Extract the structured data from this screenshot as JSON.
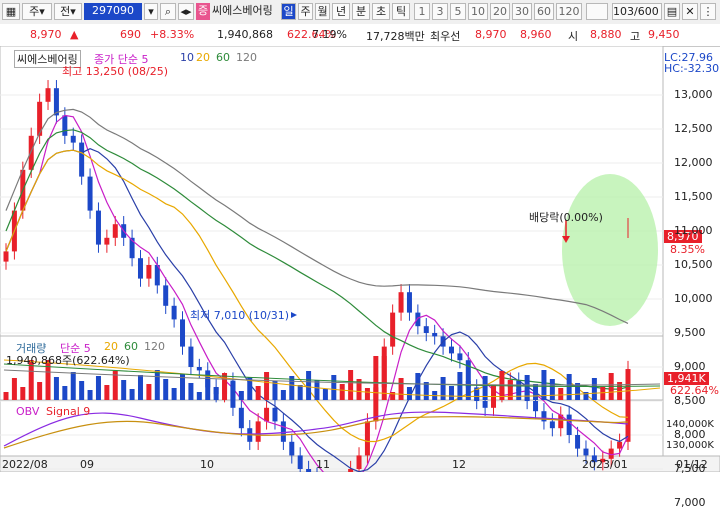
{
  "toolbar": {
    "type_selector": "주",
    "market_selector": "전",
    "code": "297090",
    "name_badge": "증",
    "stock_name": "씨에스베어링",
    "periods": [
      "일",
      "주",
      "월",
      "년",
      "분",
      "초",
      "틱"
    ],
    "active_period": "일",
    "minutes": [
      "1",
      "3",
      "5",
      "10",
      "20",
      "30",
      "60",
      "120"
    ],
    "count": "103/600"
  },
  "quote": {
    "price": "8,970",
    "change_arrow": "▲",
    "change": "690",
    "change_pct": "+8.33%",
    "volume": "1,940,868",
    "volume_pct": "622.64%",
    "turnover": "7.19%",
    "amount": "17,728백만",
    "best_label": "최우선",
    "ask": "8,970",
    "bid": "8,960",
    "open_label": "시",
    "open": "8,880",
    "high_label": "고",
    "high": "9,450"
  },
  "colors": {
    "up": "#e8202a",
    "down": "#1c48c8",
    "ma5": "#c81ec8",
    "ma10": "#2a3fa8",
    "ma20": "#e8a800",
    "ma60": "#2e8b3a",
    "ma120": "#7a7a7a"
  },
  "price_panel": {
    "name": "씨에스베어링",
    "legend_close": "종가 단순 5",
    "ma_labels": [
      "10",
      "20",
      "60",
      "120"
    ],
    "high_note": "최고 13,250 (08/25)",
    "low_note": "최저 7,010 (10/31)",
    "dividend_note": "배당락(0.00%)",
    "lc": "LC:27.96",
    "hc": "HC:-32.30",
    "y_ticks": [
      "13,000",
      "12,500",
      "12,000",
      "11,500",
      "11,000",
      "10,500",
      "10,000",
      "9,500",
      "9,000",
      "8,500",
      "8,000",
      "7,500",
      "7,000"
    ],
    "current_price_tag": "8,970",
    "current_pct_tag": "8.35%"
  },
  "volume_panel": {
    "title": "거래량",
    "ma_label": "단순 5",
    "ma_values": [
      "20",
      "60",
      "120"
    ],
    "value": "1,940,868주(622.64%)",
    "tag_value": "1,941K",
    "tag_pct": "622.64%"
  },
  "obv_panel": {
    "title": "OBV",
    "signal": "Signal 9",
    "ticks": [
      "140,000K",
      "130,000K"
    ]
  },
  "x_axis": [
    "2022/08",
    "09",
    "10",
    "11",
    "12",
    "2023/01",
    "01/12"
  ]
}
